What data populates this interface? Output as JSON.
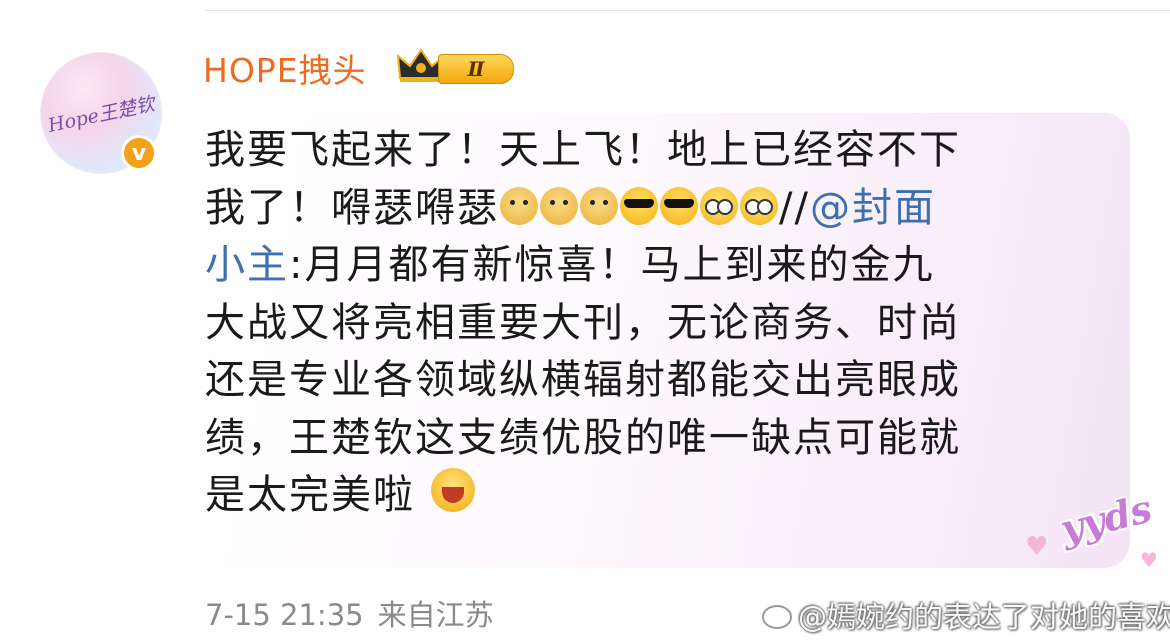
{
  "user": {
    "avatar_text": "Hope王楚钦",
    "verified_badge": "v",
    "name": "HOPE拽头",
    "vip_level": "Ⅱ"
  },
  "comment": {
    "lines": [
      "我要飞起来了！天上飞！地上已经容不下",
      "我了！嘚瑟嘚瑟",
      "小主:月月都有新惊喜！马上到来的金九",
      "大战又将亮相重要大刊，无论商务、时尚",
      "还是专业各领域纵横辐射都能交出亮眼成",
      "绩，王楚钦这支绩优股的唯一缺点可能就",
      "是太完美啦"
    ],
    "line2_suffix": "//",
    "mention": "@封面",
    "mention_tail": "小主",
    "sticker_text": "yyds"
  },
  "footer": {
    "date": "7-15 21:35",
    "location": "来自江苏"
  },
  "watermark": {
    "text": "@嫣婉约的表达了对她的喜欢"
  },
  "icons": {
    "emoji_sequence": [
      "doge",
      "doge",
      "doge",
      "cool",
      "cool",
      "nerd",
      "nerd"
    ],
    "end_emoji": "laugh"
  },
  "colors": {
    "username": "#ef6a1f",
    "mention": "#3e6fb0",
    "verified": "#f3a218",
    "meta": "#8a8a8a"
  }
}
